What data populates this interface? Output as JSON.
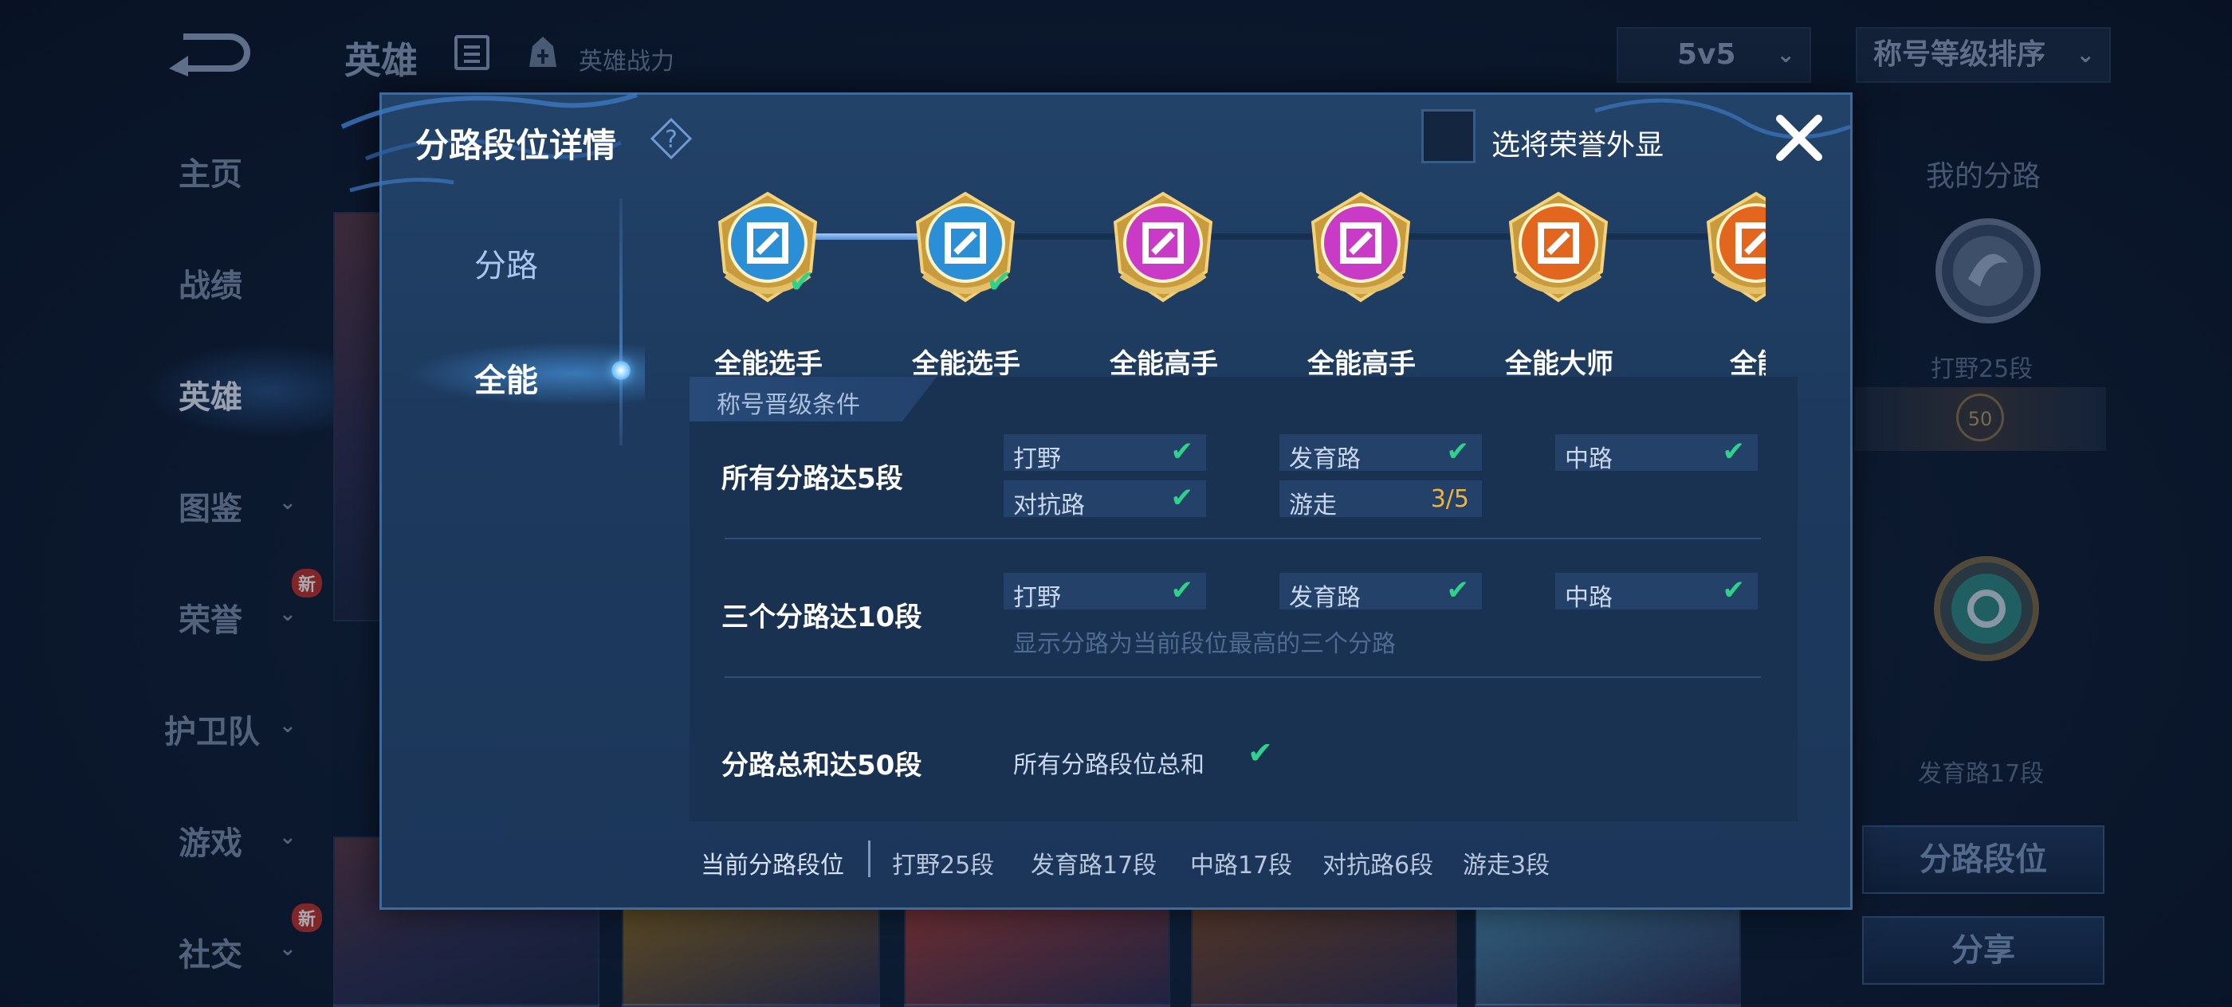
{
  "app": {
    "title": "英雄",
    "power_label": "英雄战力",
    "mode_select": "5v5",
    "sort_select": "称号等级排序"
  },
  "left_nav": [
    {
      "label": "主页",
      "badge": "",
      "has_chevron": false,
      "active": false
    },
    {
      "label": "战绩",
      "badge": "",
      "has_chevron": false,
      "active": false
    },
    {
      "label": "英雄",
      "badge": "",
      "has_chevron": false,
      "active": true
    },
    {
      "label": "图鉴",
      "badge": "",
      "has_chevron": true,
      "active": false
    },
    {
      "label": "荣誉",
      "badge": "新",
      "has_chevron": true,
      "active": false
    },
    {
      "label": "护卫队",
      "badge": "",
      "has_chevron": true,
      "active": false
    },
    {
      "label": "游戏",
      "badge": "",
      "has_chevron": true,
      "active": false
    },
    {
      "label": "社交",
      "badge": "新",
      "has_chevron": true,
      "active": false
    }
  ],
  "right_panel": {
    "title": "我的分路",
    "lane1": "打野25段",
    "lane1_level": "50",
    "lane2": "发育路17段",
    "button_lane_rank": "分路段位",
    "button_share": "分享"
  },
  "modal": {
    "title": "分路段位详情",
    "honor_display_label": "选将荣誉外显",
    "tabs": [
      {
        "label": "分路",
        "active": false
      },
      {
        "label": "全能",
        "active": true
      }
    ],
    "medals": [
      {
        "label": "全能选手",
        "color": "#2a8fd6",
        "achieved": true
      },
      {
        "label": "全能选手",
        "color": "#2a8fd6",
        "achieved": true
      },
      {
        "label": "全能高手",
        "color": "#c93bc6",
        "achieved": false
      },
      {
        "label": "全能高手",
        "color": "#c93bc6",
        "achieved": false
      },
      {
        "label": "全能大师",
        "color": "#e2661d",
        "achieved": false
      },
      {
        "label": "全能",
        "color": "#e2661d",
        "achieved": false
      }
    ],
    "conditions_header": "称号晋级条件",
    "conditions": {
      "row1": {
        "title": "所有分路达5段",
        "items": [
          {
            "lane": "打野",
            "status": "✔"
          },
          {
            "lane": "发育路",
            "status": "✔"
          },
          {
            "lane": "中路",
            "status": "✔"
          },
          {
            "lane": "对抗路",
            "status": "✔"
          },
          {
            "lane": "游走",
            "status": "3/5"
          }
        ]
      },
      "row2": {
        "title": "三个分路达10段",
        "items": [
          {
            "lane": "打野",
            "status": "✔"
          },
          {
            "lane": "发育路",
            "status": "✔"
          },
          {
            "lane": "中路",
            "status": "✔"
          }
        ],
        "hint": "显示分路为当前段位最高的三个分路"
      },
      "row3": {
        "title": "分路总和达50段",
        "label": "所有分路段位总和",
        "status": "✔"
      }
    },
    "footer": {
      "label": "当前分路段位",
      "values": [
        "打野25段",
        "发育路17段",
        "中路17段",
        "对抗路6段",
        "游走3段"
      ]
    }
  },
  "colors": {
    "check": "#2fd28a",
    "progress": "#f0b43a",
    "accent": "#3f6a9c"
  }
}
